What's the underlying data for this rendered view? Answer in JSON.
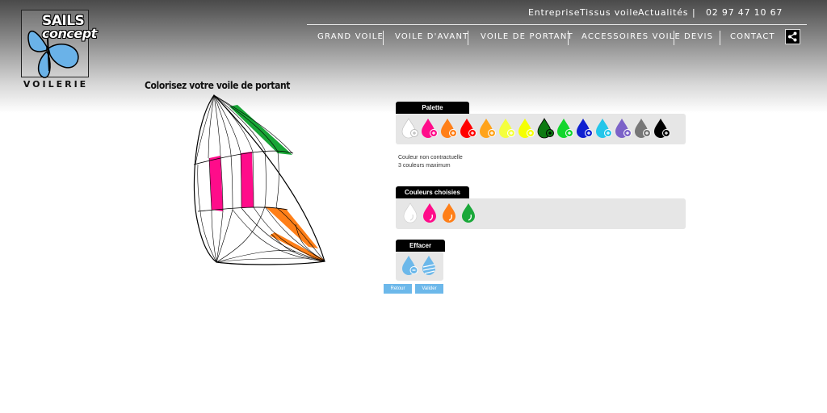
{
  "brand": {
    "line1": "SAILS",
    "line2": "concept",
    "subtitle": "VOILERIE"
  },
  "top_links": [
    {
      "label": "Entreprise"
    },
    {
      "label": "Tissus voile"
    },
    {
      "label": "Actualités"
    },
    {
      "label": "|"
    },
    {
      "label": "02 97 47 10 67"
    }
  ],
  "nav": [
    {
      "label": "GRAND VOILE"
    },
    {
      "label": "VOILE D'AVANT"
    },
    {
      "label": "VOILE DE PORTANT"
    },
    {
      "label": "ACCESSOIRES VOILE"
    },
    {
      "label": "DEVIS"
    },
    {
      "label": "CONTACT"
    }
  ],
  "share_icon": "share-icon",
  "page_title": "Colorisez votre voile de portant",
  "palette": {
    "title": "Palette",
    "colors": [
      "#ffffff",
      "#ff0c8a",
      "#ff7f18",
      "#ff0000",
      "#ffa31a",
      "#f4ff3e",
      "#f5ff00",
      "#0d7a12",
      "#12d62d",
      "#1020d0",
      "#23c6ea",
      "#7c62c8",
      "#777777",
      "#000000"
    ],
    "note_line1": "Couleur non contractuelle",
    "note_line2": "3 couleurs maximum"
  },
  "chosen": {
    "title": "Couleurs choisies",
    "colors": [
      "#ffffff",
      "#ff0c8a",
      "#ff7f18",
      "#1aa83a"
    ]
  },
  "erase": {
    "title": "Effacer"
  },
  "buttons": {
    "back": "Retour",
    "validate": "Valider"
  }
}
